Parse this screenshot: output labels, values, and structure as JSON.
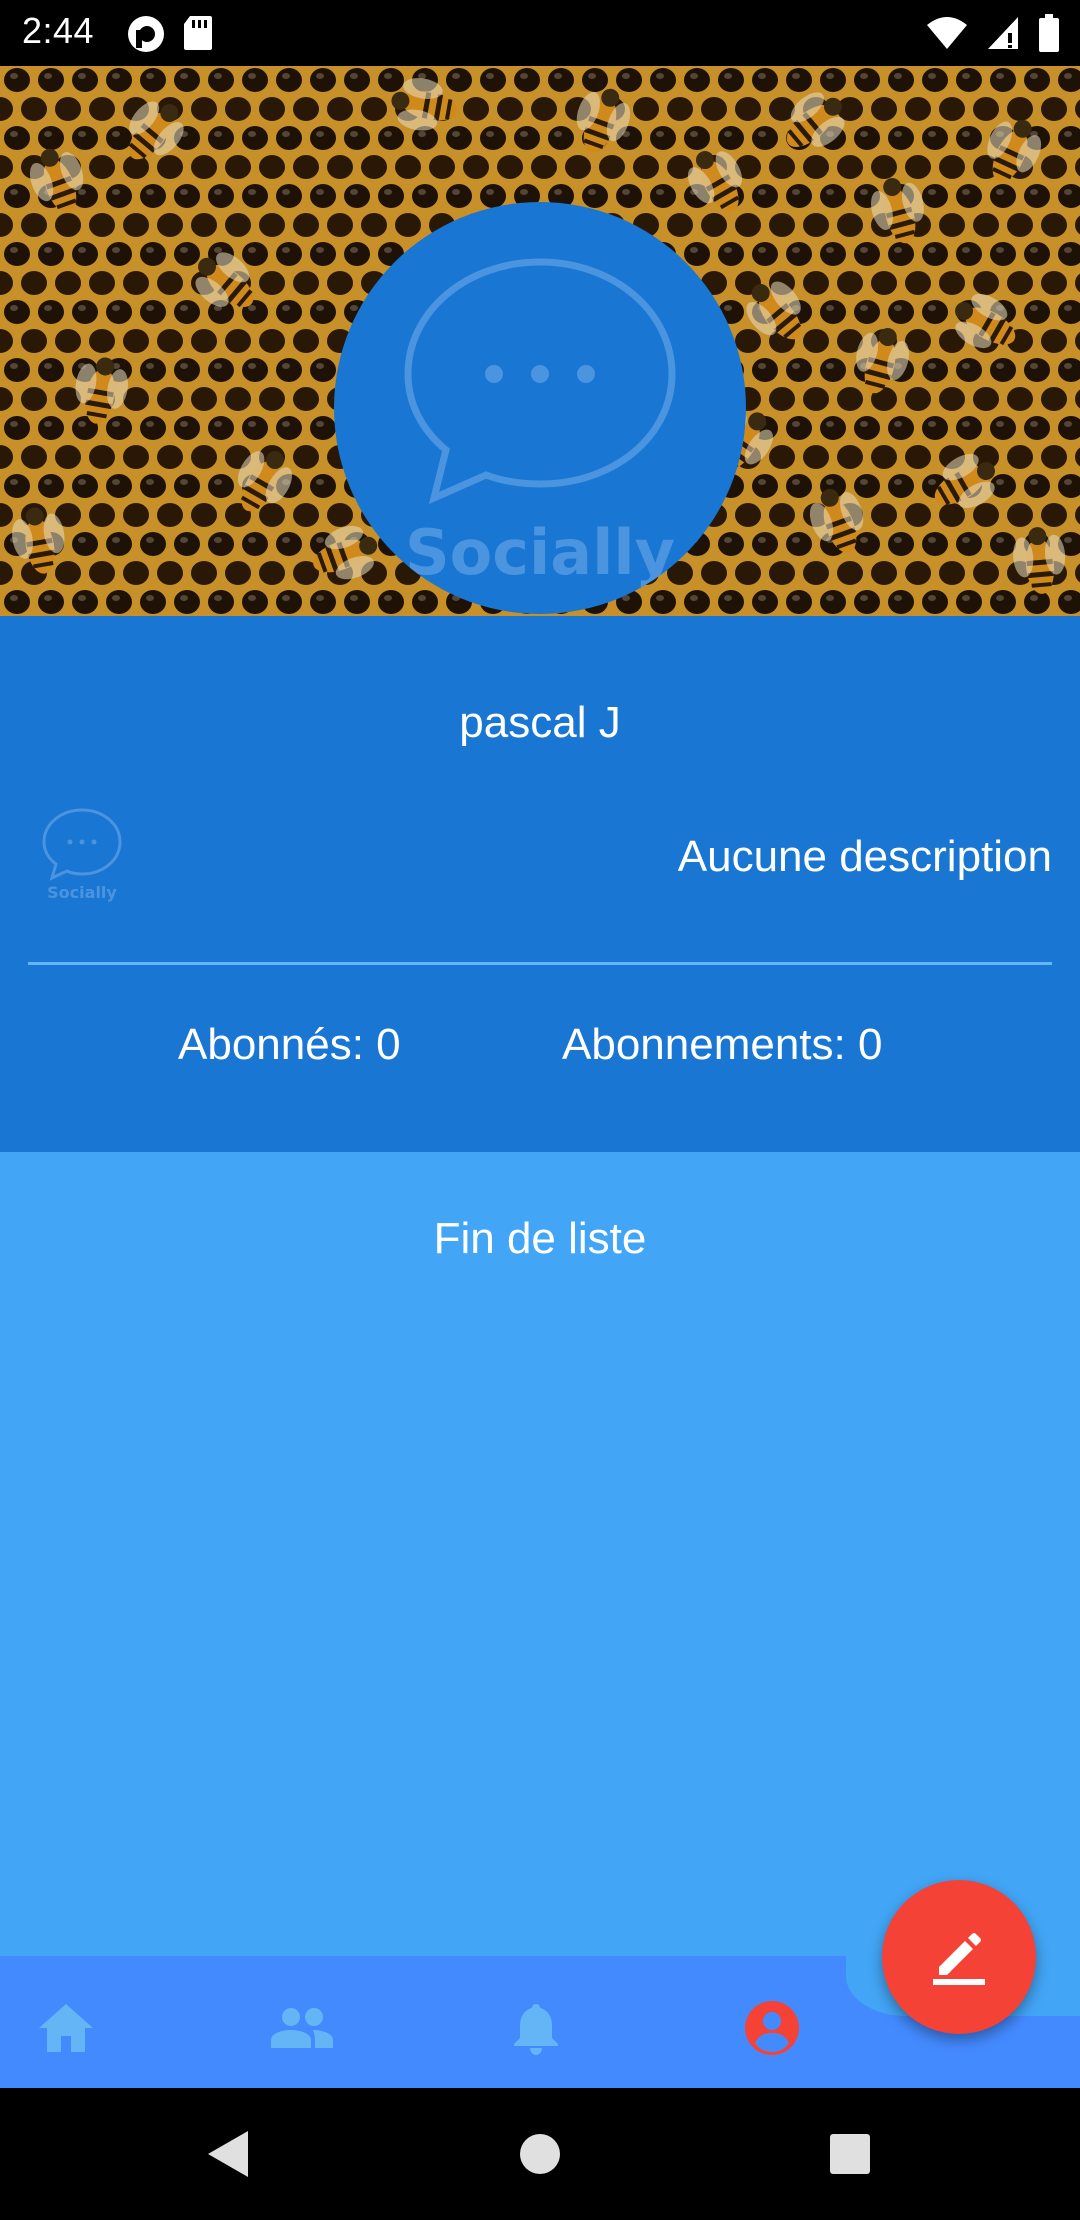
{
  "status_bar": {
    "time": "2:44",
    "left_icons": [
      "pocket-casts-icon",
      "sd-card-icon"
    ],
    "right_icons": [
      "wifi-icon",
      "cell-signal-icon",
      "battery-icon"
    ]
  },
  "cover": {
    "image": "honeycomb-bees-photo",
    "avatar_logo_text": "Socially"
  },
  "profile": {
    "username": "pascal J",
    "small_logo_text": "Socially",
    "description": "Aucune description",
    "followers_label": "Abonnés: 0",
    "following_label": "Abonnements: 0"
  },
  "list": {
    "end_text": "Fin de liste"
  },
  "bottom_nav": {
    "items": [
      {
        "name": "home",
        "icon": "home-icon",
        "active": false
      },
      {
        "name": "friends",
        "icon": "people-icon",
        "active": false
      },
      {
        "name": "notifications",
        "icon": "bell-icon",
        "active": false
      },
      {
        "name": "profile",
        "icon": "account-circle-icon",
        "active": true
      }
    ],
    "inactive_color": "#64b5f6",
    "active_color": "#f44336"
  },
  "fab": {
    "icon": "edit-pencil-icon",
    "color": "#f44336"
  },
  "colors": {
    "primary": "#1976d2",
    "background": "#42a5f5",
    "nav": "#448aff"
  }
}
